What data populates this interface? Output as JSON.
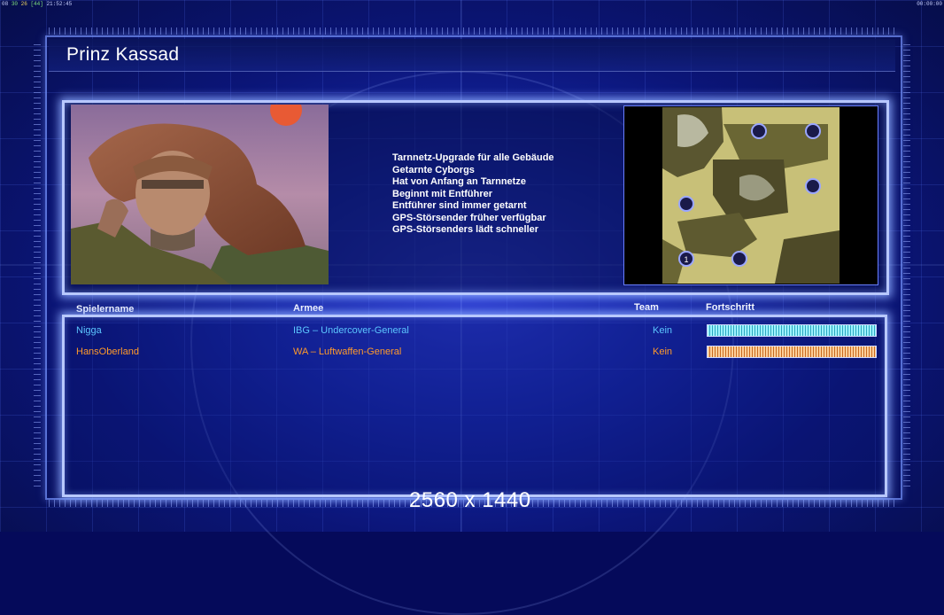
{
  "topbar": {
    "left_a": "08",
    "left_b": "30",
    "left_c": "26",
    "left_d": "[44]",
    "left_time": "21:52:45",
    "right_time": "00:00:00"
  },
  "screen": {
    "title": "Prinz Kassad",
    "features": [
      "Tarnnetz-Upgrade für alle Gebäude",
      "Getarnte Cyborgs",
      "Hat von Anfang an Tarnnetze",
      "Beginnt mit Entführer",
      "Entführer sind immer getarnt",
      "GPS-Störsender früher verfügbar",
      "GPS-Störsenders lädt schneller"
    ]
  },
  "minimap": {
    "start_marker_label": "1"
  },
  "table": {
    "headers": {
      "player": "Spielername",
      "army": "Armee",
      "team": "Team",
      "progress": "Fortschritt"
    },
    "rows": [
      {
        "player": "Nigga",
        "army": "IBG – Undercover-General",
        "team": "Kein",
        "progress": 1.0,
        "color": "#5cc6ff"
      },
      {
        "player": "HansOberland",
        "army": "WA – Luftwaffen-General",
        "team": "Kein",
        "progress": 1.0,
        "color": "#ff9a2a"
      }
    ]
  },
  "overlay": {
    "resolution": "2560 x 1440"
  }
}
